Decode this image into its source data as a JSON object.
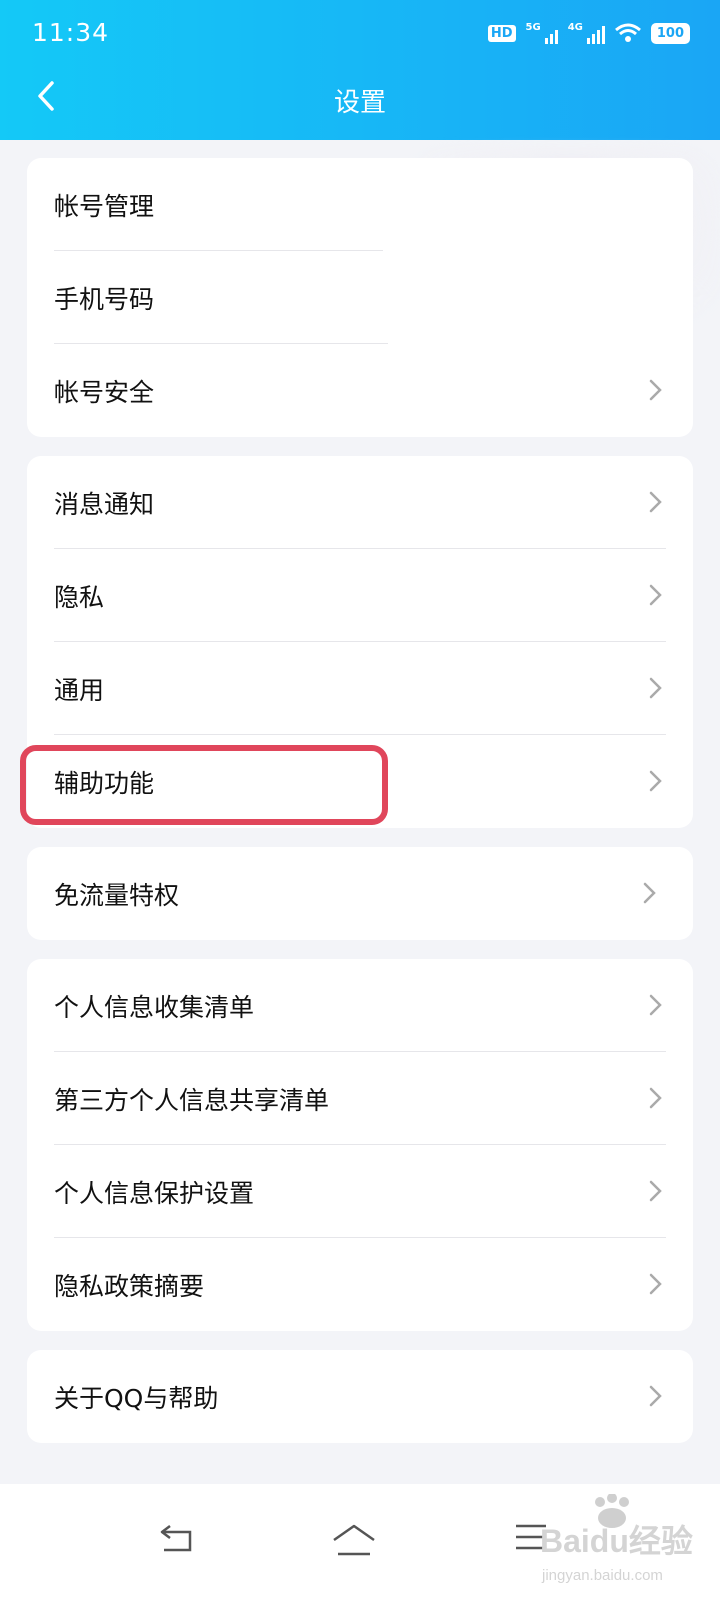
{
  "status_bar": {
    "time": "11:34",
    "hd": "HD",
    "battery": "100",
    "sig1": "5G",
    "sig2": "4G"
  },
  "header": {
    "title": "设置"
  },
  "groups": [
    {
      "items": [
        {
          "label": "帐号管理",
          "chevron": false
        },
        {
          "label": "手机号码",
          "chevron": false
        },
        {
          "label": "帐号安全",
          "chevron": true
        }
      ]
    },
    {
      "items": [
        {
          "label": "消息通知",
          "chevron": true
        },
        {
          "label": "隐私",
          "chevron": true
        },
        {
          "label": "通用",
          "chevron": true
        },
        {
          "label": "辅助功能",
          "chevron": true
        }
      ]
    },
    {
      "items": [
        {
          "label": "免流量特权",
          "chevron": true
        }
      ]
    },
    {
      "items": [
        {
          "label": "个人信息收集清单",
          "chevron": true
        },
        {
          "label": "第三方个人信息共享清单",
          "chevron": true
        },
        {
          "label": "个人信息保护设置",
          "chevron": true
        },
        {
          "label": "隐私政策摘要",
          "chevron": true
        }
      ]
    },
    {
      "items": [
        {
          "label": "关于QQ与帮助",
          "chevron": true
        }
      ]
    }
  ],
  "navbar": {
    "icons": [
      "back-icon",
      "home-icon",
      "menu-icon"
    ]
  },
  "watermark": {
    "text": "Baidu经验",
    "subtext": "jingyan.baidu.com"
  },
  "colors": {
    "header_start": "#14c9f7",
    "header_end": "#1aa6f5",
    "highlight": "#e0465b"
  }
}
